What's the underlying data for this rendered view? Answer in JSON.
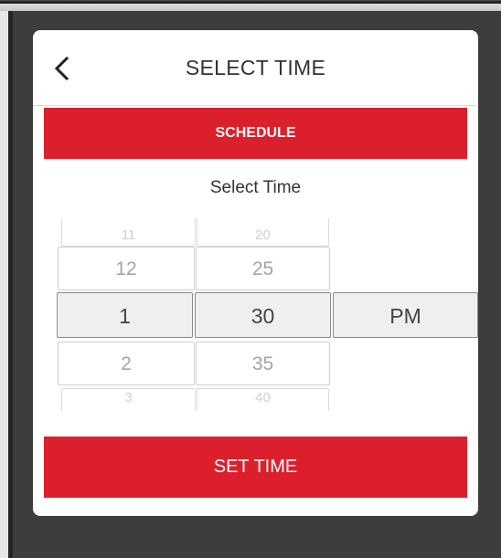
{
  "dialog": {
    "title": "SELECT TIME",
    "schedule_label": "SCHEDULE",
    "subtitle": "Select Time",
    "set_button_label": "SET TIME"
  },
  "picker": {
    "hours": [
      "11",
      "12",
      "1",
      "2",
      "3"
    ],
    "minutes": [
      "20",
      "25",
      "30",
      "35",
      "40"
    ],
    "selected_hour": "1",
    "selected_minute": "30",
    "period": "PM"
  },
  "colors": {
    "accent": "#dc1f2c",
    "overlay": "#3d3d3d"
  },
  "icons": {
    "back": "chevron-left-icon"
  }
}
